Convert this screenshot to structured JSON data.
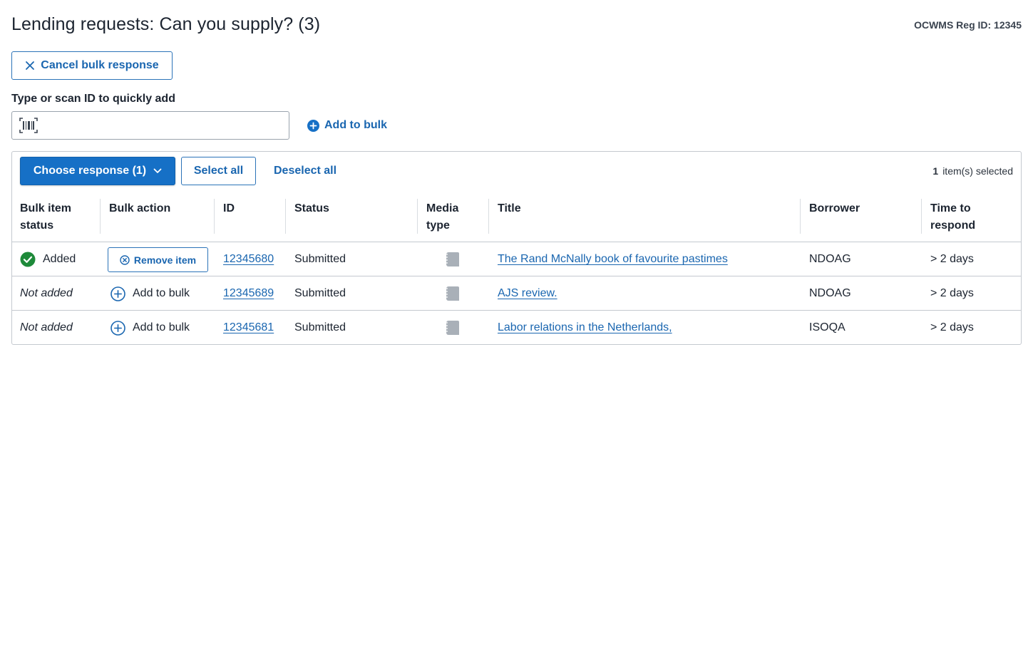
{
  "header": {
    "title": "Lending requests: Can you supply? (3)",
    "reg_id": "OCWMS Reg ID: 12345"
  },
  "actions": {
    "cancel_label": "Cancel bulk response"
  },
  "quick_add": {
    "label": "Type or scan ID to quickly add",
    "value": "",
    "placeholder": "",
    "add_label": "Add to bulk"
  },
  "toolbar": {
    "choose_label": "Choose response (1)",
    "select_all_label": "Select all",
    "deselect_all_label": "Deselect all",
    "selected_count": "1",
    "selected_suffix": "item(s) selected"
  },
  "table": {
    "headers": {
      "bulk_status": "Bulk item status",
      "bulk_action": "Bulk action",
      "id": "ID",
      "status": "Status",
      "media_type": "Media type",
      "title": "Title",
      "borrower": "Borrower",
      "time": "Time to respond"
    },
    "rows": [
      {
        "bulk_status": "Added",
        "bulk_action": "Remove item",
        "id": "12345680",
        "status": "Submitted",
        "media_icon": "book-icon",
        "title": "The Rand McNally book of favourite pastimes",
        "borrower": "NDOAG",
        "time": "> 2 days"
      },
      {
        "bulk_status": "Not added",
        "bulk_action": "Add to bulk",
        "id": "12345689",
        "status": "Submitted",
        "media_icon": "book-icon",
        "title": "AJS review.",
        "borrower": "NDOAG",
        "time": "> 2 days"
      },
      {
        "bulk_status": "Not added",
        "bulk_action": "Add to bulk",
        "id": "12345681",
        "status": "Submitted",
        "media_icon": "book-icon",
        "title": "Labor relations in the Netherlands,",
        "borrower": "ISOQA",
        "time": "> 2 days"
      }
    ]
  },
  "colors": {
    "primary": "#1670c6",
    "link": "#1a66b0",
    "success": "#1e8a3a",
    "border": "#c4c9cf"
  }
}
